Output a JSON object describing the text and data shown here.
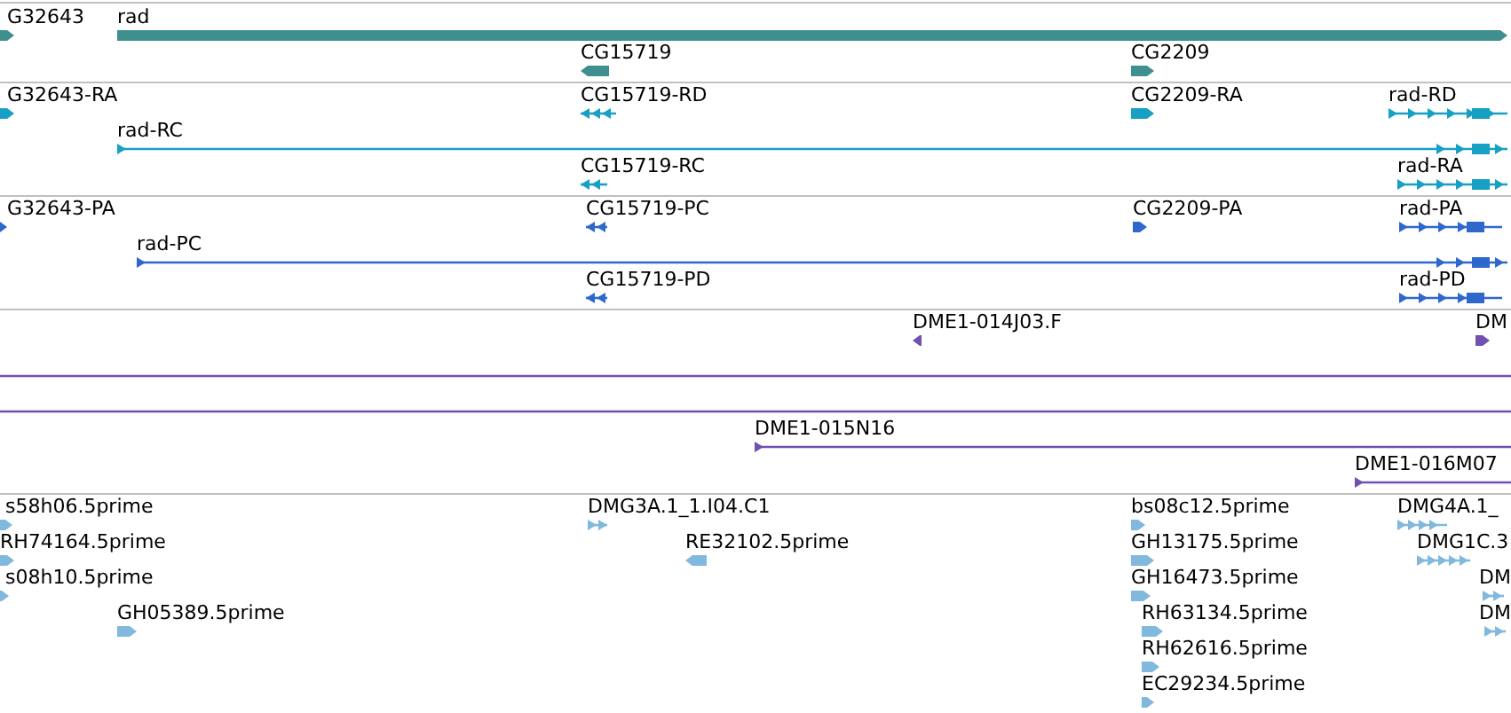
{
  "tracks": [
    {
      "color": "#3f8f8f",
      "features": [
        {
          "label": "G32643",
          "kind": "bar",
          "reverse": false
        },
        {
          "label": "rad",
          "kind": "bar",
          "reverse": false
        },
        {
          "label": "CG15719",
          "kind": "bar",
          "reverse": true
        },
        {
          "label": "CG2209",
          "kind": "bar",
          "reverse": false
        }
      ]
    },
    {
      "color": "#17a0c4",
      "features": [
        {
          "label": "G32643-RA",
          "kind": "bar",
          "reverse": false
        },
        {
          "label": "CG15719-RD",
          "kind": "exons",
          "reverse": true
        },
        {
          "label": "CG2209-RA",
          "kind": "bar",
          "reverse": false
        },
        {
          "label": "rad-RD",
          "kind": "exons",
          "reverse": false
        },
        {
          "label": "rad-RC",
          "kind": "long",
          "reverse": false
        },
        {
          "label": "CG15719-RC",
          "kind": "exons",
          "reverse": true
        },
        {
          "label": "rad-RA",
          "kind": "exons",
          "reverse": false
        }
      ]
    },
    {
      "color": "#2f68cc",
      "features": [
        {
          "label": "G32643-PA",
          "kind": "bar",
          "reverse": false
        },
        {
          "label": "CG15719-PC",
          "kind": "exons",
          "reverse": true
        },
        {
          "label": "CG2209-PA",
          "kind": "bar",
          "reverse": false
        },
        {
          "label": "rad-PA",
          "kind": "exons",
          "reverse": false
        },
        {
          "label": "rad-PC",
          "kind": "long",
          "reverse": false
        },
        {
          "label": "CG15719-PD",
          "kind": "exons",
          "reverse": true
        },
        {
          "label": "rad-PD",
          "kind": "exons",
          "reverse": false
        }
      ]
    },
    {
      "color": "#7050b0",
      "features": [
        {
          "label": "DME1-014J03.F",
          "kind": "bar",
          "reverse": true
        },
        {
          "label": "DM",
          "kind": "bar",
          "reverse": false
        },
        {
          "kind": "line"
        },
        {
          "kind": "line"
        },
        {
          "label": "DME1-015N16",
          "kind": "arrowline",
          "reverse": false
        },
        {
          "label": "DME1-016M07",
          "kind": "arrowline",
          "reverse": false
        }
      ]
    },
    {
      "color": "#80b8de",
      "features": [
        {
          "label": "s58h06.5prime",
          "kind": "bar",
          "reverse": false
        },
        {
          "label": "RH74164.5prime",
          "kind": "bar",
          "reverse": false
        },
        {
          "label": "s08h10.5prime",
          "kind": "bar",
          "reverse": false
        },
        {
          "label": "GH05389.5prime",
          "kind": "bar",
          "reverse": false
        },
        {
          "label": "DMG3A.1_1.I04.C1",
          "kind": "exons",
          "reverse": false
        },
        {
          "label": "RE32102.5prime",
          "kind": "bar",
          "reverse": true
        },
        {
          "label": "bs08c12.5prime",
          "kind": "bar",
          "reverse": false
        },
        {
          "label": "GH13175.5prime",
          "kind": "bar",
          "reverse": false
        },
        {
          "label": "GH16473.5prime",
          "kind": "bar",
          "reverse": false
        },
        {
          "label": "RH63134.5prime",
          "kind": "bar",
          "reverse": false
        },
        {
          "label": "RH62616.5prime",
          "kind": "bar",
          "reverse": false
        },
        {
          "label": "EC29234.5prime",
          "kind": "bar",
          "reverse": false
        },
        {
          "label": "DMG4A.1_",
          "kind": "exons",
          "reverse": false
        },
        {
          "label": "DMG1C.3",
          "kind": "exons",
          "reverse": false
        },
        {
          "label": "DM",
          "kind": "exons",
          "reverse": false
        },
        {
          "label": "DM",
          "kind": "exons",
          "reverse": false
        }
      ]
    }
  ]
}
